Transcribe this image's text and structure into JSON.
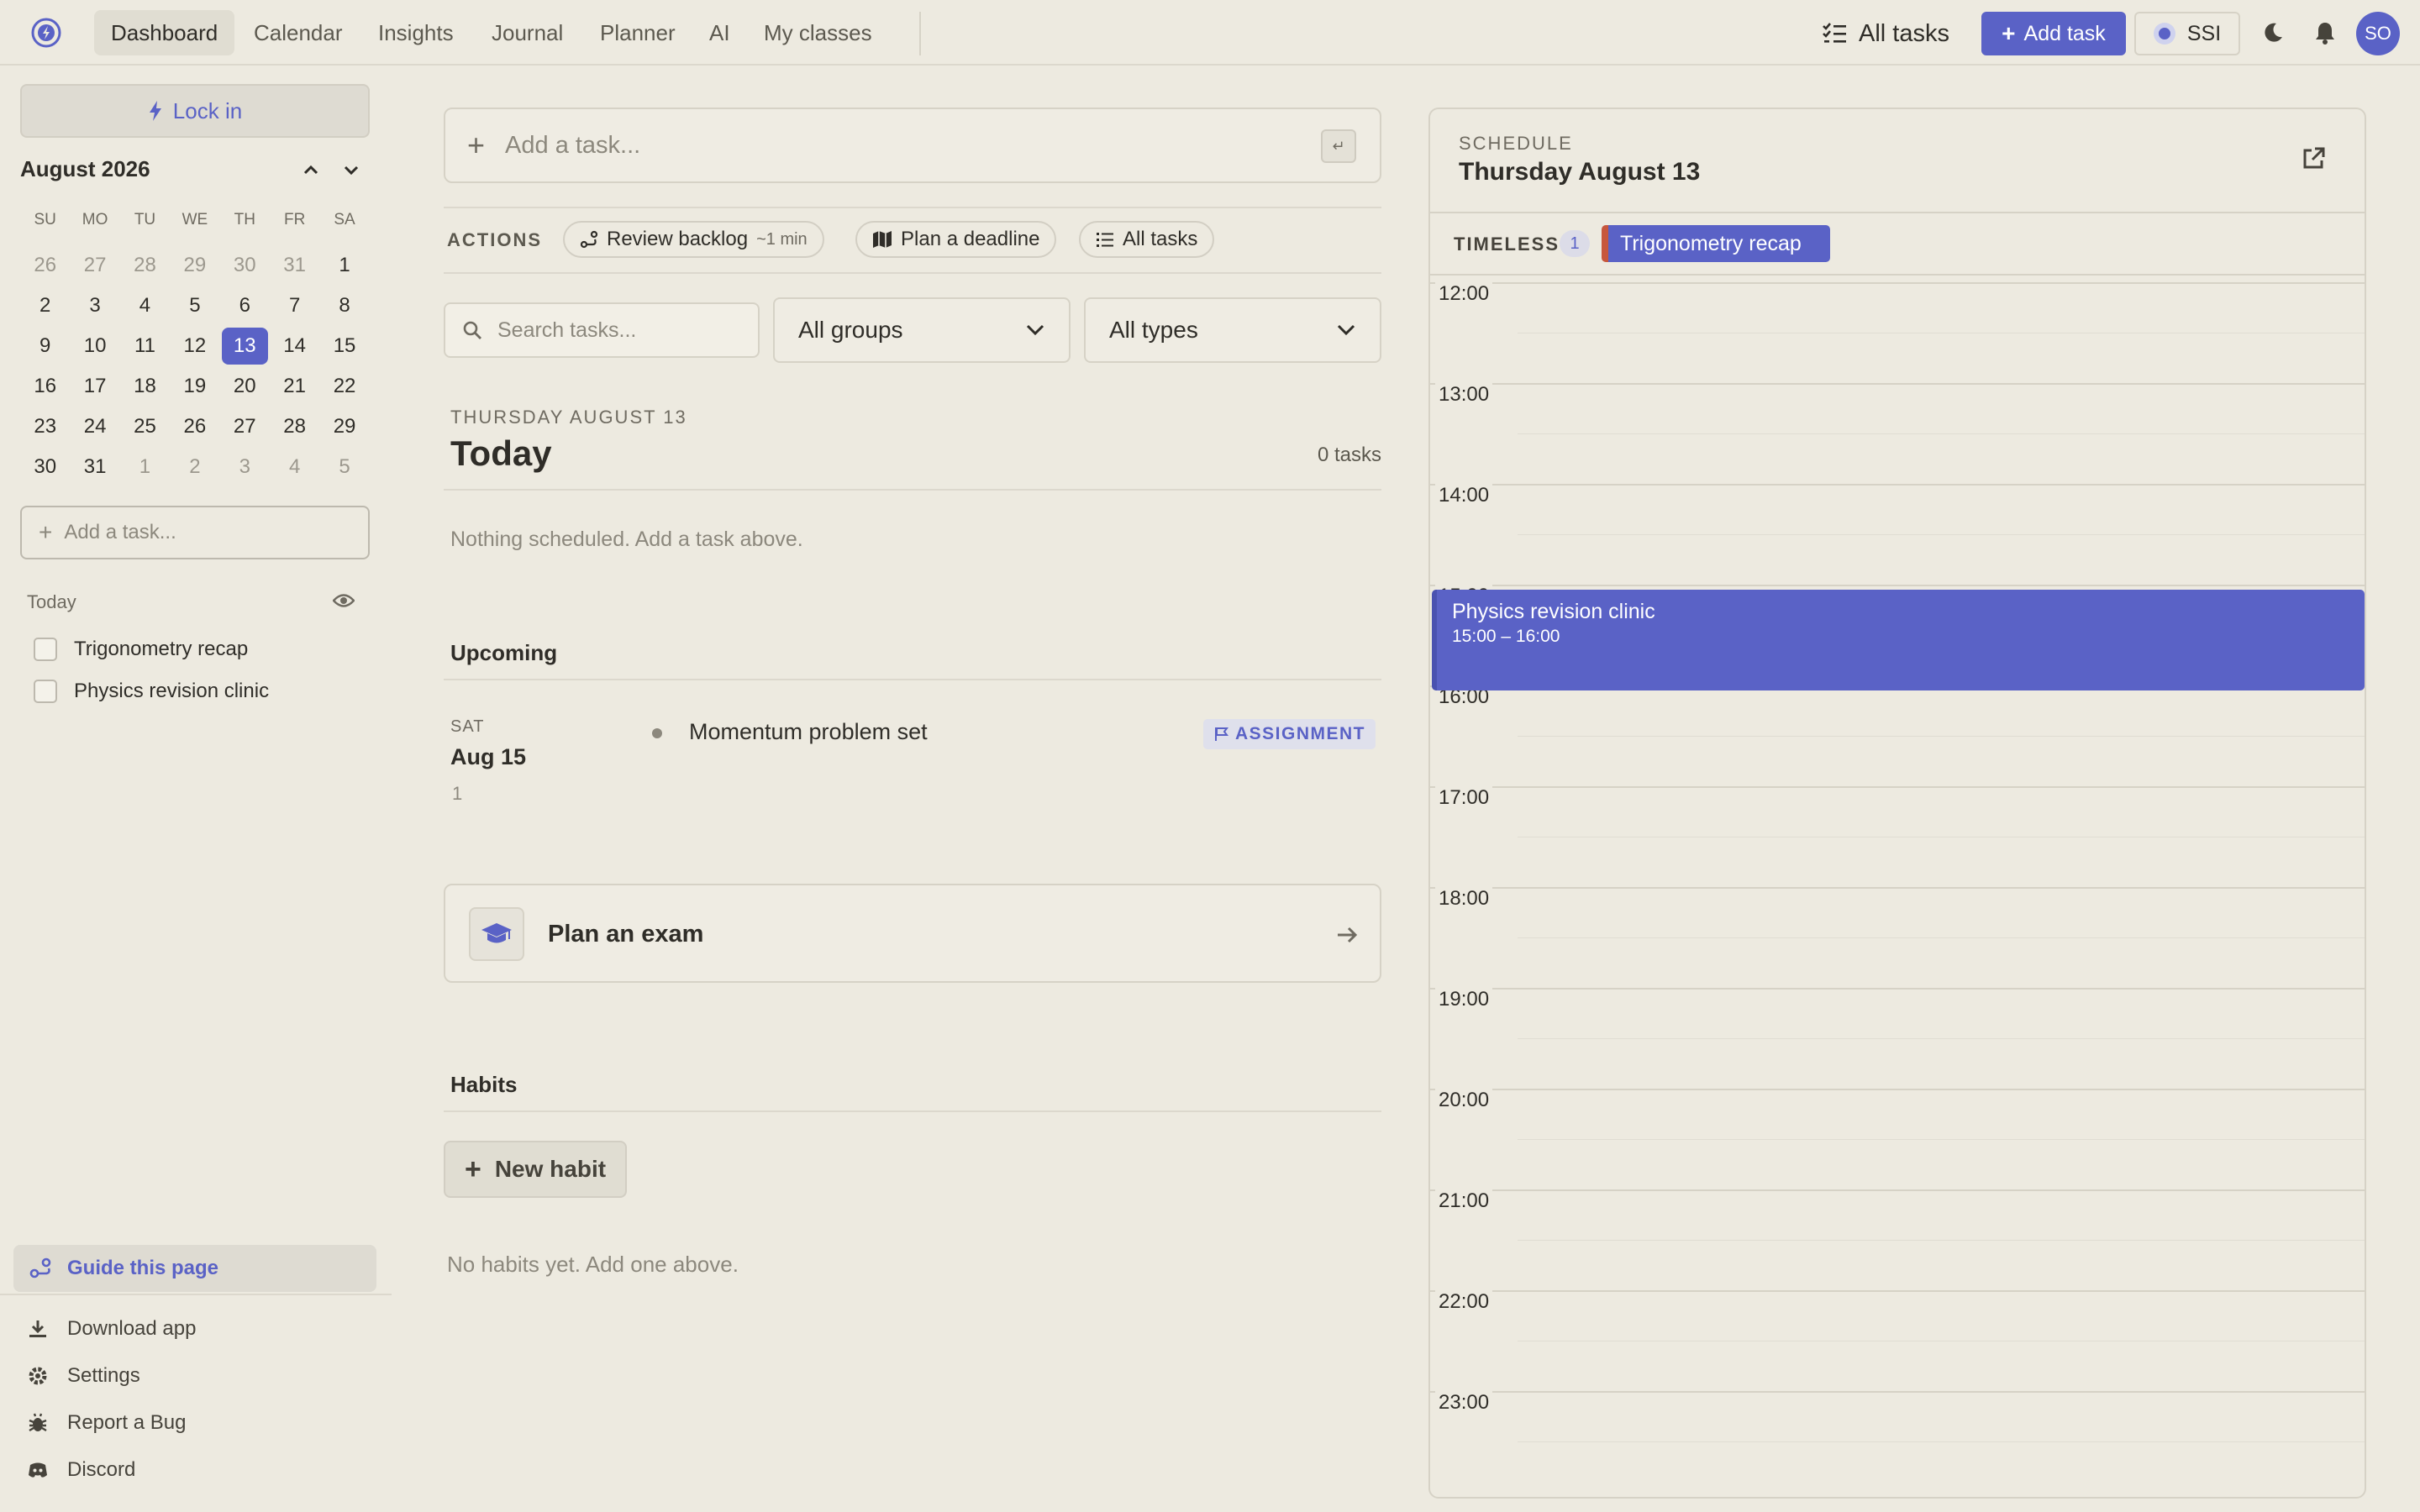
{
  "topbar": {
    "nav": [
      "Dashboard",
      "Calendar",
      "Insights",
      "Journal",
      "Planner",
      "AI",
      "My classes"
    ],
    "all_tasks_label": "All tasks",
    "add_task_label": "Add task",
    "ssi_label": "SSI",
    "avatar_initials": "SO"
  },
  "sidebar": {
    "lock_in_label": "Lock in",
    "calendar": {
      "month": "August 2026",
      "weekdays": [
        "SU",
        "MO",
        "TU",
        "WE",
        "TH",
        "FR",
        "SA"
      ],
      "weeks": [
        [
          "26",
          "27",
          "28",
          "29",
          "30",
          "31",
          "1"
        ],
        [
          "2",
          "3",
          "4",
          "5",
          "6",
          "7",
          "8"
        ],
        [
          "9",
          "10",
          "11",
          "12",
          "13",
          "14",
          "15"
        ],
        [
          "16",
          "17",
          "18",
          "19",
          "20",
          "21",
          "22"
        ],
        [
          "23",
          "24",
          "25",
          "26",
          "27",
          "28",
          "29"
        ],
        [
          "30",
          "31",
          "1",
          "2",
          "3",
          "4",
          "5"
        ]
      ],
      "selected": "13"
    },
    "add_task_placeholder": "Add a task...",
    "today_label": "Today",
    "today_tasks": [
      "Trigonometry recap",
      "Physics revision clinic"
    ],
    "guide_label": "Guide this page",
    "footer_links": [
      "Download app",
      "Settings",
      "Report a Bug",
      "Discord"
    ]
  },
  "main": {
    "add_task_placeholder": "Add a task...",
    "enter_key": "↵",
    "actions_label": "ACTIONS",
    "actions": {
      "review_backlog": "Review backlog",
      "review_backlog_time": "~1 min",
      "plan_deadline": "Plan a deadline",
      "all_tasks": "All tasks"
    },
    "search_placeholder": "Search tasks...",
    "group_filter": "All groups",
    "type_filter": "All types",
    "today": {
      "eyebrow": "THURSDAY AUGUST 13",
      "title": "Today",
      "count": "0 tasks",
      "empty": "Nothing scheduled. Add a task above."
    },
    "upcoming": {
      "title": "Upcoming",
      "day": "SAT",
      "date": "Aug 15",
      "count": "1",
      "task": "Momentum problem set",
      "badge": "ASSIGNMENT"
    },
    "plan_exam_label": "Plan an exam",
    "habits": {
      "title": "Habits",
      "new_label": "New habit",
      "empty": "No habits yet. Add one above."
    }
  },
  "schedule": {
    "eyebrow": "SCHEDULE",
    "title": "Thursday August 13",
    "timeless_label": "TIMELESS",
    "timeless_count": "1",
    "timeless_task": "Trigonometry recap",
    "hours": [
      "12:00",
      "13:00",
      "14:00",
      "15:00",
      "16:00",
      "17:00",
      "18:00",
      "19:00",
      "20:00",
      "21:00",
      "22:00",
      "23:00"
    ],
    "event": {
      "title": "Physics revision clinic",
      "time": "15:00 – 16:00"
    },
    "colors": {
      "event": "#5a62c6",
      "timeless_accent": "#c7573d"
    }
  }
}
